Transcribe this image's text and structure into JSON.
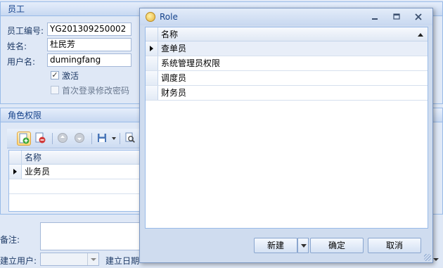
{
  "employee_panel": {
    "title": "员工",
    "id_label": "员工编号:",
    "id_value": "YG201309250002",
    "name_label": "姓名:",
    "name_value": "杜民芳",
    "username_label": "用户名:",
    "username_value": "dumingfang",
    "active_label": "激活",
    "active_checked": true,
    "first_login_label": "首次登录修改密码",
    "first_login_checked": false
  },
  "role_panel": {
    "title": "角色权限",
    "grid_header": "名称",
    "rows": [
      "业务员"
    ]
  },
  "footer": {
    "remark_label": "备注:",
    "created_user_label": "建立用户:",
    "created_date_label": "建立日期"
  },
  "role_dialog": {
    "title": "Role",
    "column_header": "名称",
    "rows": [
      "查单员",
      "系统管理员权限",
      "调度员",
      "财务员"
    ],
    "new_button": "新建",
    "ok_button": "确定",
    "cancel_button": "取消"
  }
}
